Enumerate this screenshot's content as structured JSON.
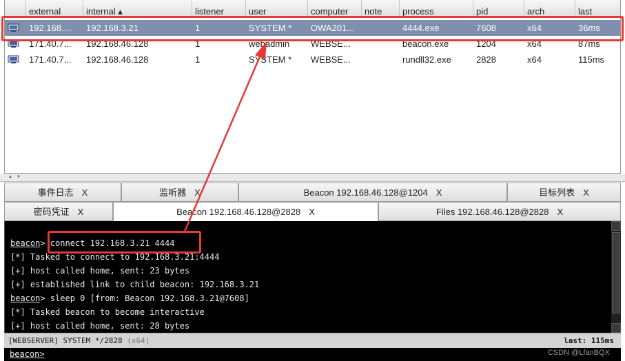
{
  "sessions_table": {
    "columns": [
      "external",
      "internal ▴",
      "listener",
      "user",
      "computer",
      "note",
      "process",
      "pid",
      "arch",
      "last"
    ],
    "rows": [
      {
        "external": "192.168....",
        "internal": "192.168.3.21",
        "listener": "1",
        "user": "SYSTEM *",
        "computer": "OWA201...",
        "note": "",
        "process": "4444.exe",
        "pid": "7608",
        "arch": "x64",
        "last": "36ms",
        "selected": true
      },
      {
        "external": "171.40.7...",
        "internal": "192.168.46.128",
        "listener": "1",
        "user": "webadmin",
        "computer": "WEBSE...",
        "note": "",
        "process": "beacon.exe",
        "pid": "1204",
        "arch": "x64",
        "last": "87ms",
        "selected": false
      },
      {
        "external": "171.40.7...",
        "internal": "192.168.46.128",
        "listener": "1",
        "user": "SYSTEM *",
        "computer": "WEBSE...",
        "note": "",
        "process": "rundll32.exe",
        "pid": "2828",
        "arch": "x64",
        "last": "115ms",
        "selected": false
      }
    ]
  },
  "tabs_row1": [
    {
      "label": "事件日志",
      "close": "X"
    },
    {
      "label": "监听器",
      "close": "X"
    },
    {
      "label": "Beacon 192.168.46.128@1204",
      "close": "X"
    },
    {
      "label": "目标列表",
      "close": "X"
    }
  ],
  "tabs_row2": [
    {
      "label": "密码凭证",
      "close": "X"
    },
    {
      "label": "Beacon 192.168.46.128@2828",
      "close": "X"
    },
    {
      "label": "Files 192.168.46.128@2828",
      "close": "X"
    }
  ],
  "console": {
    "lines": [
      {
        "prompt": "beacon",
        "marker": "",
        "text": "> connect 192.168.3.21 4444"
      },
      {
        "prompt": "",
        "marker": "[*]",
        "text": " Tasked to connect to 192.168.3.21:4444"
      },
      {
        "prompt": "",
        "marker": "[+]",
        "text": " host called home, sent: 23 bytes"
      },
      {
        "prompt": "",
        "marker": "[+]",
        "text": " established link to child beacon: 192.168.3.21"
      },
      {
        "prompt": "beacon",
        "marker": "",
        "text": "> sleep 0 [from: Beacon 192.168.3.21@7608]"
      },
      {
        "prompt": "",
        "marker": "[*]",
        "text": " Tasked beacon to become interactive"
      },
      {
        "prompt": "",
        "marker": "[+]",
        "text": " host called home, sent: 28 bytes"
      }
    ]
  },
  "statusbar": {
    "left": "[WEBSERVER] SYSTEM */2828",
    "arch": "(x64)",
    "right": "last: 115ms"
  },
  "input": {
    "prompt": "beacon>",
    "value": ""
  },
  "watermark": "CSDN @LfanBQX",
  "colors": {
    "selected_row": "#7f8fad",
    "annotation": "#e53935",
    "console_bg": "#000000"
  }
}
